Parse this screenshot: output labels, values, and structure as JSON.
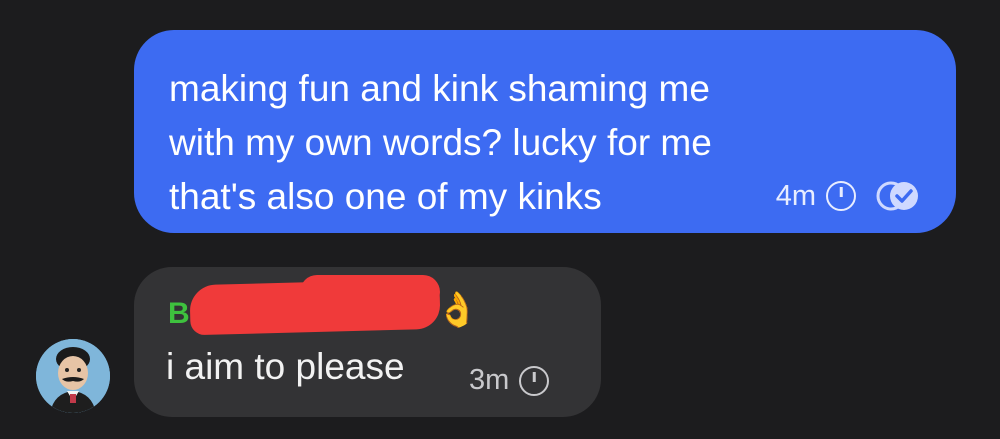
{
  "outgoing_message": {
    "lines": [
      "making fun and kink shaming me",
      "with my own words? lucky for me",
      "that's also one of my kinks"
    ],
    "time": "4m",
    "clock_icon": "clock-icon",
    "status_icon": "read-receipt-icon"
  },
  "incoming_message": {
    "sender_visible": "B",
    "emoji": "👌",
    "text": "i aim to please",
    "time": "3m",
    "clock_icon": "clock-icon"
  },
  "colors": {
    "background": "#1c1c1e",
    "outgoing_bubble": "#3d6bf2",
    "incoming_bubble": "#333335",
    "sender_name": "#3ec23e",
    "redaction": "#f03a3a"
  }
}
